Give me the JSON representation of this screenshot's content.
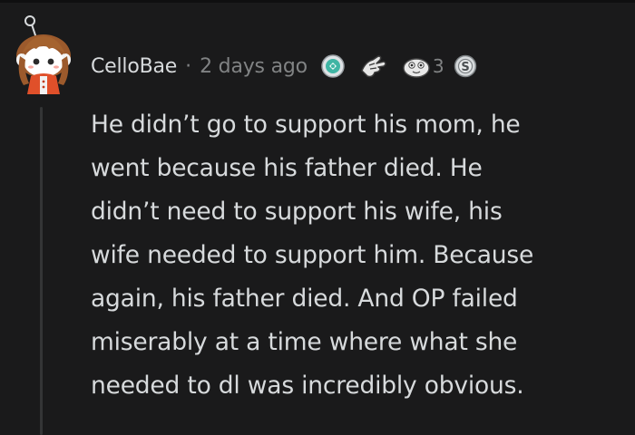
{
  "comment": {
    "username": "CelloBae",
    "separator": "·",
    "timestamp": "2 days ago",
    "awards": [
      {
        "icon": "wholesome-award-icon"
      },
      {
        "icon": "helpful-award-icon"
      },
      {
        "icon": "hugz-award-icon",
        "count": "3"
      },
      {
        "icon": "silver-award-icon"
      }
    ],
    "body": "He didn’t go to support his mom, he\nwent because his father died. He\ndidn’t need to support his wife, his\nwife needed to support him. Because\nagain, his father died. And OP failed\nmiserably at a time where what she\nneeded to dl was incredibly obvious."
  },
  "colors": {
    "background": "#1a1a1b",
    "text": "#d7dadc",
    "meta": "#818384",
    "thread_line": "#343536"
  }
}
